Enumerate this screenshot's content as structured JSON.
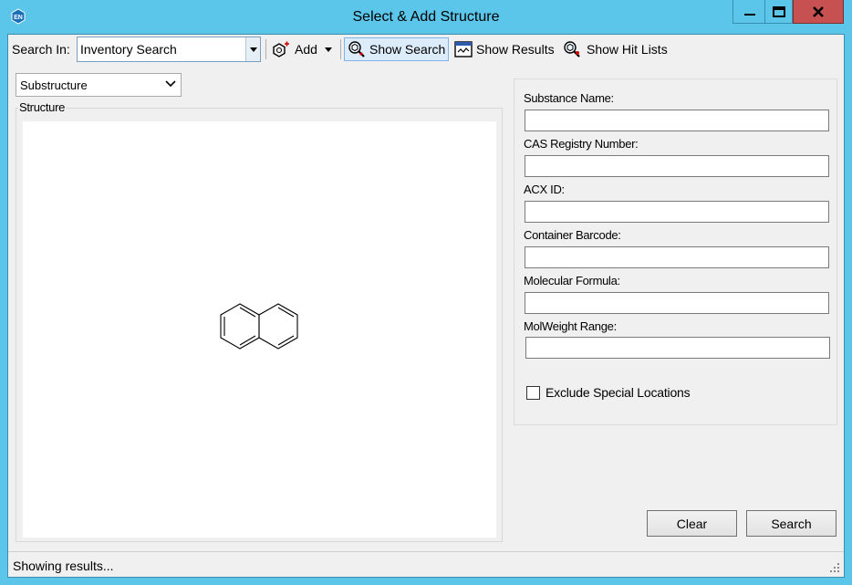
{
  "window": {
    "title": "Select & Add Structure",
    "app_icon_text": "EN",
    "accent": "#5bc6ea"
  },
  "toolbar": {
    "search_in_label": "Search In:",
    "search_in_value": "Inventory Search",
    "add_label": "Add",
    "show_search_label": "Show Search",
    "show_results_label": "Show Results",
    "show_hit_lists_label": "Show Hit Lists"
  },
  "search_type": {
    "value": "Substructure"
  },
  "structure": {
    "group_label": "Structure",
    "molecule_icon": "naphthalene-structure"
  },
  "fields": [
    {
      "label": "Substance Name:",
      "value": ""
    },
    {
      "label": "CAS Registry Number:",
      "value": ""
    },
    {
      "label": "ACX ID:",
      "value": ""
    },
    {
      "label": "Container Barcode:",
      "value": ""
    },
    {
      "label": "Molecular Formula:",
      "value": ""
    },
    {
      "label": "MolWeight Range:",
      "value": ""
    }
  ],
  "exclude_special_locations": {
    "label": "Exclude Special Locations",
    "checked": false
  },
  "buttons": {
    "clear": "Clear",
    "search": "Search"
  },
  "status": {
    "text": "Showing results..."
  }
}
